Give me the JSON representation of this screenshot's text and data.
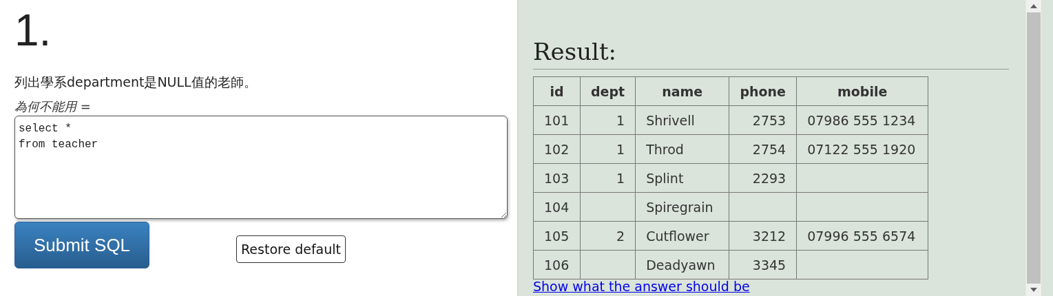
{
  "question": {
    "number": "1.",
    "text": "列出學系department是NULL值的老師。",
    "hint": "為何不能用 =",
    "sql": "select *\nfrom teacher"
  },
  "buttons": {
    "submit": "Submit SQL",
    "restore": "Restore default"
  },
  "result": {
    "title": "Result:",
    "columns": [
      "id",
      "dept",
      "name",
      "phone",
      "mobile"
    ],
    "rows": [
      [
        "101",
        "1",
        "Shrivell",
        "2753",
        "07986 555 1234"
      ],
      [
        "102",
        "1",
        "Throd",
        "2754",
        "07122 555 1920"
      ],
      [
        "103",
        "1",
        "Splint",
        "2293",
        ""
      ],
      [
        "104",
        "",
        "Spiregrain",
        "",
        ""
      ],
      [
        "105",
        "2",
        "Cutflower",
        "3212",
        "07996 555 6574"
      ],
      [
        "106",
        "",
        "Deadyawn",
        "3345",
        ""
      ]
    ],
    "link": "Show what the answer should be"
  }
}
